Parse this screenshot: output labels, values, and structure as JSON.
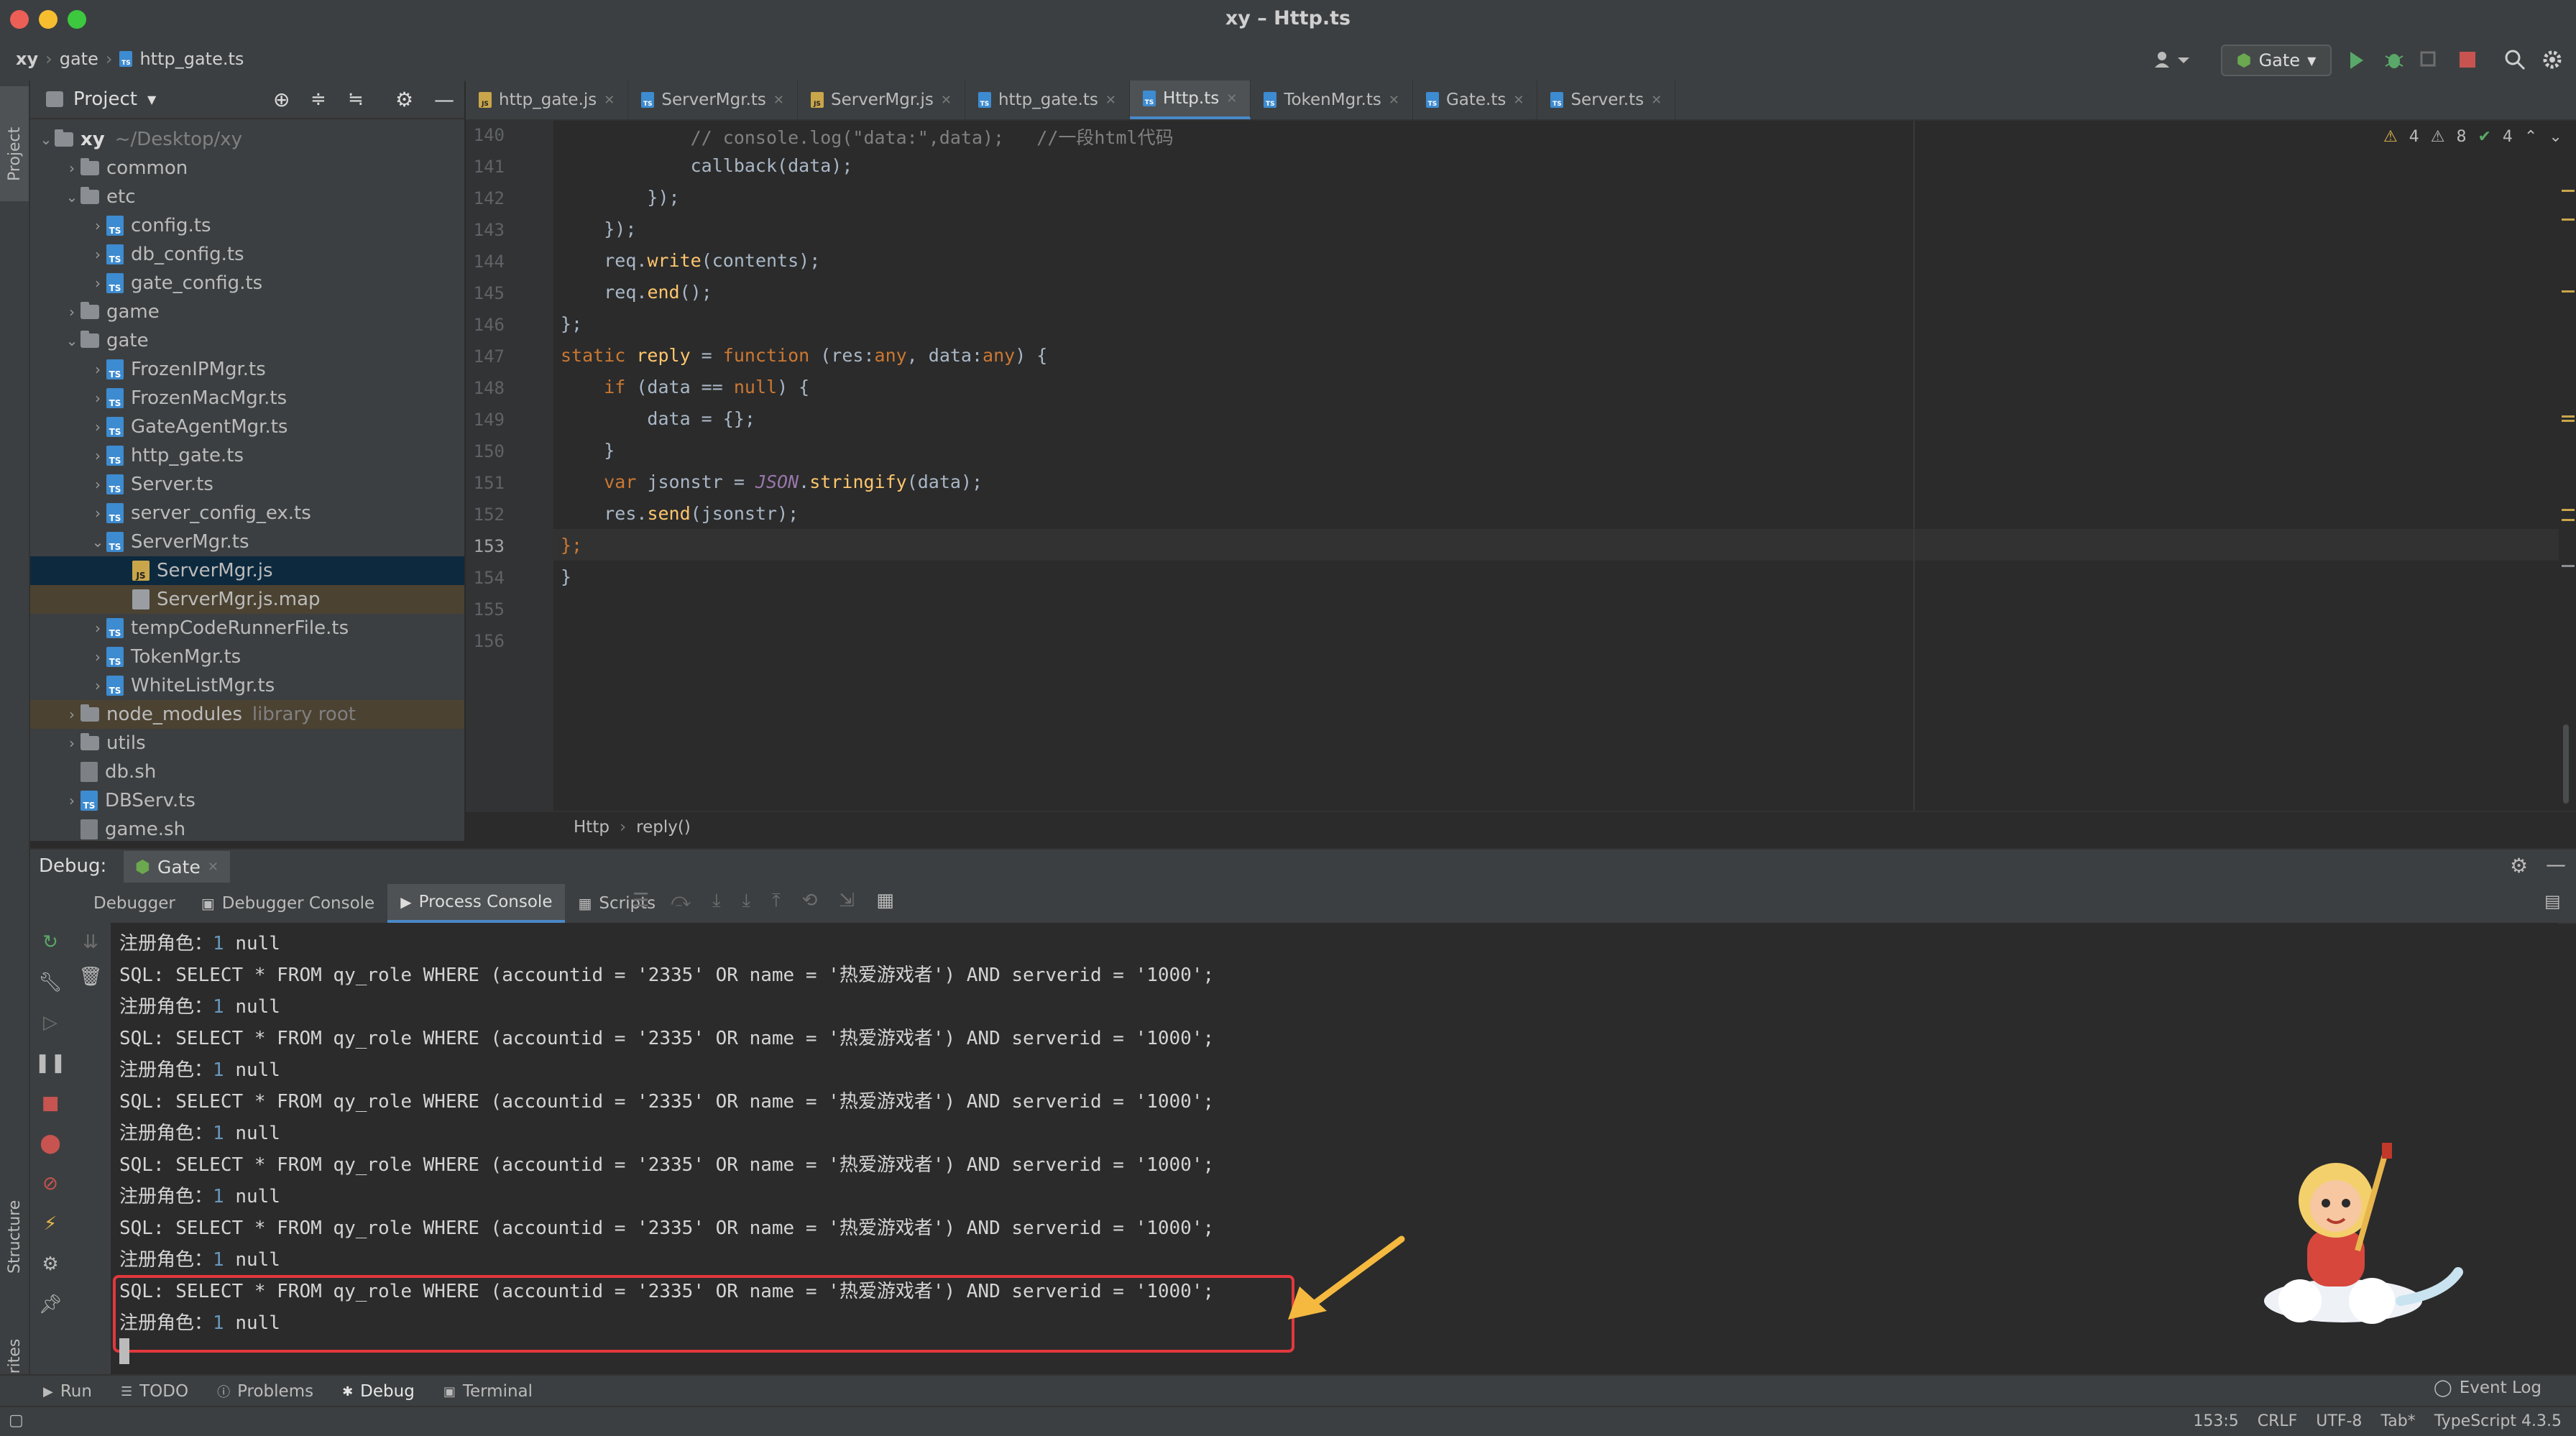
{
  "window": {
    "title": "xy – Http.ts"
  },
  "navbar": {
    "crumbs": [
      "xy",
      "gate",
      "http_gate.ts"
    ],
    "run_config": "Gate"
  },
  "project": {
    "header": "Project",
    "root": {
      "name": "xy",
      "path": "~/Desktop/xy"
    },
    "tree": [
      {
        "label": "common",
        "type": "folder",
        "depth": 1,
        "arrow": "right"
      },
      {
        "label": "etc",
        "type": "folder",
        "depth": 1,
        "arrow": "down"
      },
      {
        "label": "config.ts",
        "type": "ts",
        "depth": 2,
        "arrow": "right"
      },
      {
        "label": "db_config.ts",
        "type": "ts",
        "depth": 2,
        "arrow": "right"
      },
      {
        "label": "gate_config.ts",
        "type": "ts",
        "depth": 2,
        "arrow": "right"
      },
      {
        "label": "game",
        "type": "folder",
        "depth": 1,
        "arrow": "right"
      },
      {
        "label": "gate",
        "type": "folder",
        "depth": 1,
        "arrow": "down"
      },
      {
        "label": "FrozenIPMgr.ts",
        "type": "ts",
        "depth": 2,
        "arrow": "right"
      },
      {
        "label": "FrozenMacMgr.ts",
        "type": "ts",
        "depth": 2,
        "arrow": "right"
      },
      {
        "label": "GateAgentMgr.ts",
        "type": "ts",
        "depth": 2,
        "arrow": "right"
      },
      {
        "label": "http_gate.ts",
        "type": "ts",
        "depth": 2,
        "arrow": "right"
      },
      {
        "label": "Server.ts",
        "type": "ts",
        "depth": 2,
        "arrow": "right"
      },
      {
        "label": "server_config_ex.ts",
        "type": "ts",
        "depth": 2,
        "arrow": "right"
      },
      {
        "label": "ServerMgr.ts",
        "type": "ts",
        "depth": 2,
        "arrow": "down"
      },
      {
        "label": "ServerMgr.js",
        "type": "js",
        "depth": 3,
        "arrow": "",
        "state": "sel"
      },
      {
        "label": "ServerMgr.js.map",
        "type": "map",
        "depth": 3,
        "arrow": "",
        "state": "sel2"
      },
      {
        "label": "tempCodeRunnerFile.ts",
        "type": "ts",
        "depth": 2,
        "arrow": "right"
      },
      {
        "label": "TokenMgr.ts",
        "type": "ts",
        "depth": 2,
        "arrow": "right"
      },
      {
        "label": "WhiteListMgr.ts",
        "type": "ts",
        "depth": 2,
        "arrow": "right"
      },
      {
        "label": "node_modules",
        "type": "folder",
        "depth": 1,
        "arrow": "right",
        "hint": "library root",
        "state": "lib"
      },
      {
        "label": "utils",
        "type": "folder",
        "depth": 1,
        "arrow": "right"
      },
      {
        "label": "db.sh",
        "type": "sh",
        "depth": 1,
        "arrow": ""
      },
      {
        "label": "DBServ.ts",
        "type": "ts",
        "depth": 1,
        "arrow": "right"
      },
      {
        "label": "game.sh",
        "type": "sh",
        "depth": 1,
        "arrow": ""
      }
    ]
  },
  "tabs": [
    {
      "label": "http_gate.js",
      "type": "js"
    },
    {
      "label": "ServerMgr.ts",
      "type": "ts"
    },
    {
      "label": "ServerMgr.js",
      "type": "js"
    },
    {
      "label": "http_gate.ts",
      "type": "ts"
    },
    {
      "label": "Http.ts",
      "type": "ts",
      "active": true
    },
    {
      "label": "TokenMgr.ts",
      "type": "ts"
    },
    {
      "label": "Gate.ts",
      "type": "ts"
    },
    {
      "label": "Server.ts",
      "type": "ts"
    }
  ],
  "inspections": {
    "warn1": "4",
    "warn2": "8",
    "ok": "4"
  },
  "editor": {
    "line_numbers": [
      "140",
      "141",
      "142",
      "143",
      "144",
      "145",
      "146",
      "147",
      "148",
      "149",
      "150",
      "151",
      "152",
      "153",
      "154",
      "155",
      "156"
    ],
    "lines": [
      {
        "indent": "            ",
        "parts": [
          [
            "cm",
            "// console.log(\"data:\",data);   //一段html代码"
          ]
        ]
      },
      {
        "indent": "            ",
        "parts": [
          [
            "",
            "callback(data);"
          ]
        ]
      },
      {
        "indent": "        ",
        "parts": [
          [
            "",
            "});"
          ]
        ]
      },
      {
        "indent": "    ",
        "parts": [
          [
            "",
            "});"
          ]
        ]
      },
      {
        "indent": "    ",
        "parts": [
          [
            "",
            "req."
          ],
          [
            "fn",
            "write"
          ],
          [
            "",
            "(contents);"
          ]
        ]
      },
      {
        "indent": "    ",
        "parts": [
          [
            "",
            "req."
          ],
          [
            "fn",
            "end"
          ],
          [
            "",
            "();"
          ]
        ]
      },
      {
        "indent": "",
        "parts": [
          [
            "",
            "};"
          ]
        ]
      },
      {
        "indent": "",
        "parts": [
          [
            "kw",
            "static "
          ],
          [
            "fn",
            "reply"
          ],
          [
            "",
            " = "
          ],
          [
            "kw",
            "function "
          ],
          [
            "",
            "(res:"
          ],
          [
            "kw",
            "any"
          ],
          [
            "",
            ", data:"
          ],
          [
            "kw",
            "any"
          ],
          [
            "",
            ") {"
          ]
        ]
      },
      {
        "indent": "    ",
        "parts": [
          [
            "kw",
            "if "
          ],
          [
            "",
            "(data == "
          ],
          [
            "kw",
            "null"
          ],
          [
            "",
            ") {"
          ]
        ]
      },
      {
        "indent": "        ",
        "parts": [
          [
            "",
            "data = {};"
          ]
        ]
      },
      {
        "indent": "    ",
        "parts": [
          [
            "",
            "}"
          ]
        ]
      },
      {
        "indent": "    ",
        "parts": [
          [
            "kw",
            "var "
          ],
          [
            "",
            "jsonstr = "
          ],
          [
            "cls",
            "JSON"
          ],
          [
            "",
            "."
          ],
          [
            "fn",
            "stringify"
          ],
          [
            "",
            "(data);"
          ]
        ]
      },
      {
        "indent": "    ",
        "parts": [
          [
            "",
            "res."
          ],
          [
            "fn",
            "send"
          ],
          [
            "",
            "(jsonstr);"
          ]
        ]
      },
      {
        "indent": "",
        "parts": [
          [
            "kw",
            "};"
          ]
        ]
      },
      {
        "indent": "",
        "parts": [
          [
            "",
            "}"
          ]
        ]
      },
      {
        "indent": "",
        "parts": [
          [
            "",
            ""
          ]
        ]
      },
      {
        "indent": "",
        "parts": [
          [
            "",
            ""
          ]
        ]
      }
    ],
    "breadcrumb": [
      "Http",
      "reply()"
    ]
  },
  "debug": {
    "label": "Debug:",
    "session": "Gate",
    "tabs": [
      {
        "label": "Debugger"
      },
      {
        "label": "Debugger Console"
      },
      {
        "label": "Process Console",
        "active": true
      },
      {
        "label": "Scripts"
      }
    ],
    "console": [
      {
        "kind": "role",
        "text": "注册角色：",
        "num": "1",
        "tail": " null"
      },
      {
        "kind": "sql",
        "text": "SQL: SELECT * FROM qy_role WHERE (accountid = '2335' OR name = '热爱游戏者') AND serverid = '1000';"
      },
      {
        "kind": "role",
        "text": "注册角色：",
        "num": "1",
        "tail": " null"
      },
      {
        "kind": "sql",
        "text": "SQL: SELECT * FROM qy_role WHERE (accountid = '2335' OR name = '热爱游戏者') AND serverid = '1000';"
      },
      {
        "kind": "role",
        "text": "注册角色：",
        "num": "1",
        "tail": " null"
      },
      {
        "kind": "sql",
        "text": "SQL: SELECT * FROM qy_role WHERE (accountid = '2335' OR name = '热爱游戏者') AND serverid = '1000';"
      },
      {
        "kind": "role",
        "text": "注册角色：",
        "num": "1",
        "tail": " null"
      },
      {
        "kind": "sql",
        "text": "SQL: SELECT * FROM qy_role WHERE (accountid = '2335' OR name = '热爱游戏者') AND serverid = '1000';"
      },
      {
        "kind": "role",
        "text": "注册角色：",
        "num": "1",
        "tail": " null"
      },
      {
        "kind": "sql",
        "text": "SQL: SELECT * FROM qy_role WHERE (accountid = '2335' OR name = '热爱游戏者') AND serverid = '1000';"
      },
      {
        "kind": "role",
        "text": "注册角色：",
        "num": "1",
        "tail": " null"
      },
      {
        "kind": "sql",
        "text": "SQL: SELECT * FROM qy_role WHERE (accountid = '2335' OR name = '热爱游戏者') AND serverid = '1000';"
      },
      {
        "kind": "role",
        "text": "注册角色：",
        "num": "1",
        "tail": " null"
      }
    ]
  },
  "left_strip": {
    "project": "Project",
    "structure": "Structure",
    "favorites": "Favorites"
  },
  "toolwindows": [
    {
      "label": "Run",
      "icon": "run-icon"
    },
    {
      "label": "TODO",
      "icon": "todo-icon"
    },
    {
      "label": "Problems",
      "icon": "problems-icon"
    },
    {
      "label": "Debug",
      "icon": "debug-icon",
      "active": true
    },
    {
      "label": "Terminal",
      "icon": "terminal-icon"
    }
  ],
  "event_log": "Event Log",
  "status": {
    "position": "153:5",
    "line_sep": "CRLF",
    "encoding": "UTF-8",
    "indent": "Tab*",
    "language": "TypeScript 4.3.5"
  },
  "colors": {
    "accent": "#4a88c7",
    "highlight_box": "#e2383d",
    "arrow": "#f4b93e"
  }
}
